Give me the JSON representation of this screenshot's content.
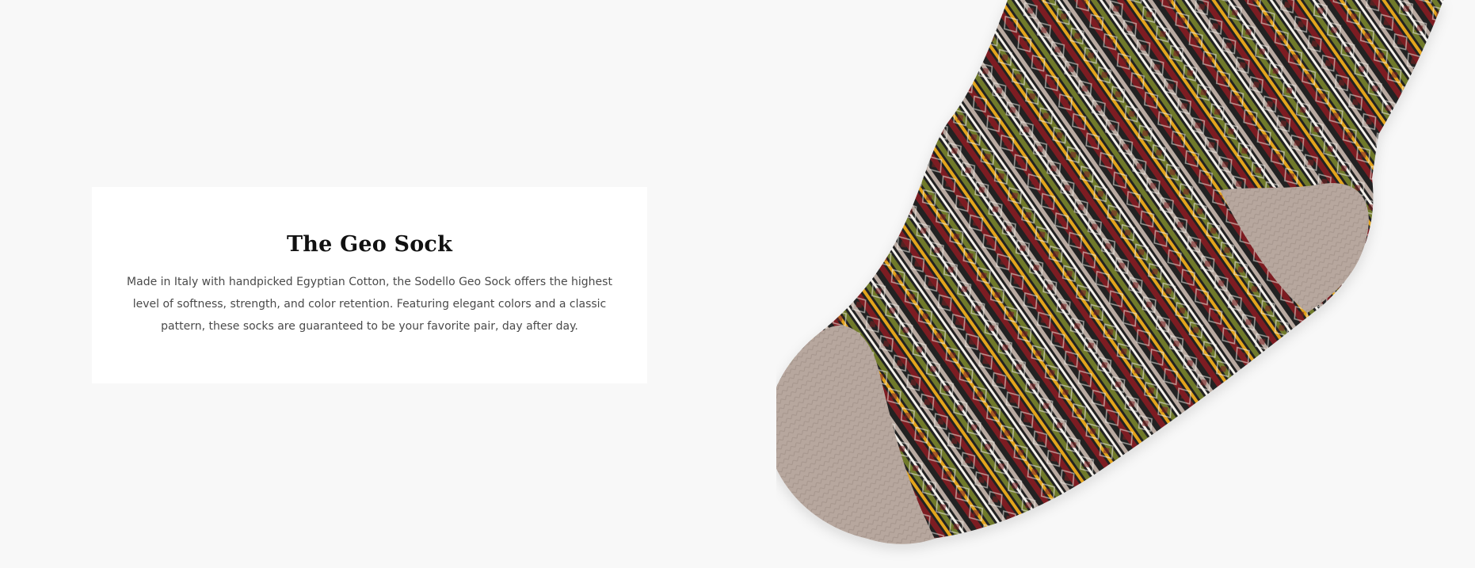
{
  "product": {
    "title": "The Geo Sock",
    "description": "Made in Italy with handpicked Egyptian Cotton, the Sodello Geo Sock offers the highest level of softness, strength, and color retention. Featuring elegant colors and a classic pattern, these socks are guaranteed to be your favorite pair, day after day."
  },
  "image": {
    "subject": "patterned-knit-sock",
    "colors": {
      "background": "#f8f8f8",
      "knit_black": "#232323",
      "knit_red": "#7d1f22",
      "knit_olive": "#6f7a2c",
      "knit_mustard": "#e3a41f",
      "knit_beige": "#b9aaa1",
      "knit_white": "#f3f0ea"
    }
  }
}
